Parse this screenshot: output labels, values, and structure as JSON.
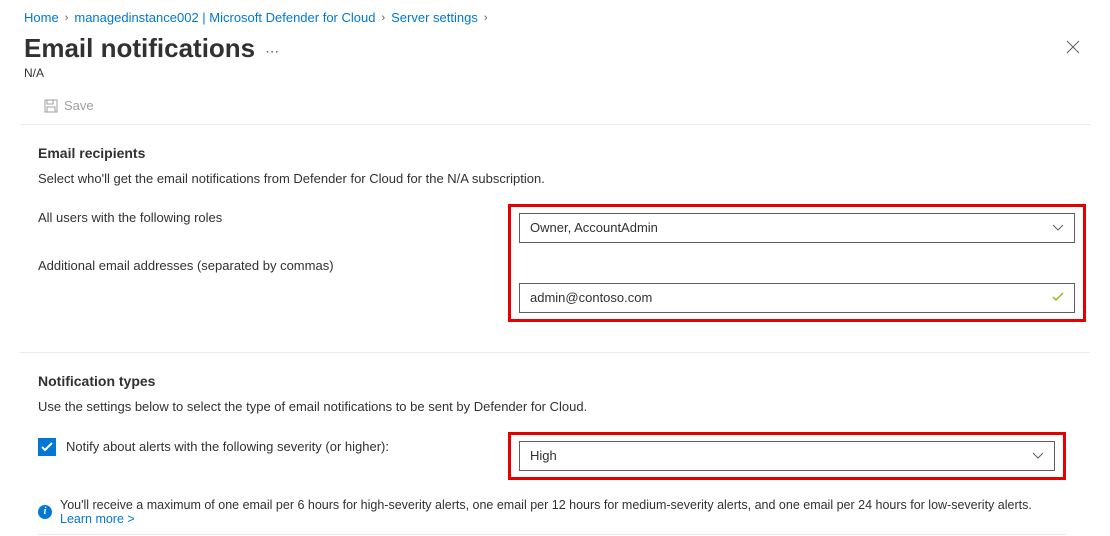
{
  "breadcrumb": {
    "home": "Home",
    "instance": "managedinstance002 | Microsoft Defender for Cloud",
    "server_settings": "Server settings"
  },
  "page": {
    "title": "Email notifications",
    "subtitle": "N/A"
  },
  "toolbar": {
    "save_label": "Save"
  },
  "recipients": {
    "heading": "Email recipients",
    "description": "Select who'll get the email notifications from Defender for Cloud for the N/A subscription.",
    "roles_label": "All users with the following roles",
    "roles_value": "Owner, AccountAdmin",
    "emails_label": "Additional email addresses (separated by commas)",
    "emails_value": "admin@contoso.com"
  },
  "notification_types": {
    "heading": "Notification types",
    "description": "Use the settings below to select the type of email notifications to be sent by Defender for Cloud.",
    "severity_label": "Notify about alerts with the following severity (or higher):",
    "severity_value": "High",
    "info_text": "You'll receive a maximum of one email per 6 hours for high-severity alerts, one email per 12 hours for medium-severity alerts, and one email per 24 hours for low-severity alerts.",
    "learn_more": "Learn more >"
  }
}
